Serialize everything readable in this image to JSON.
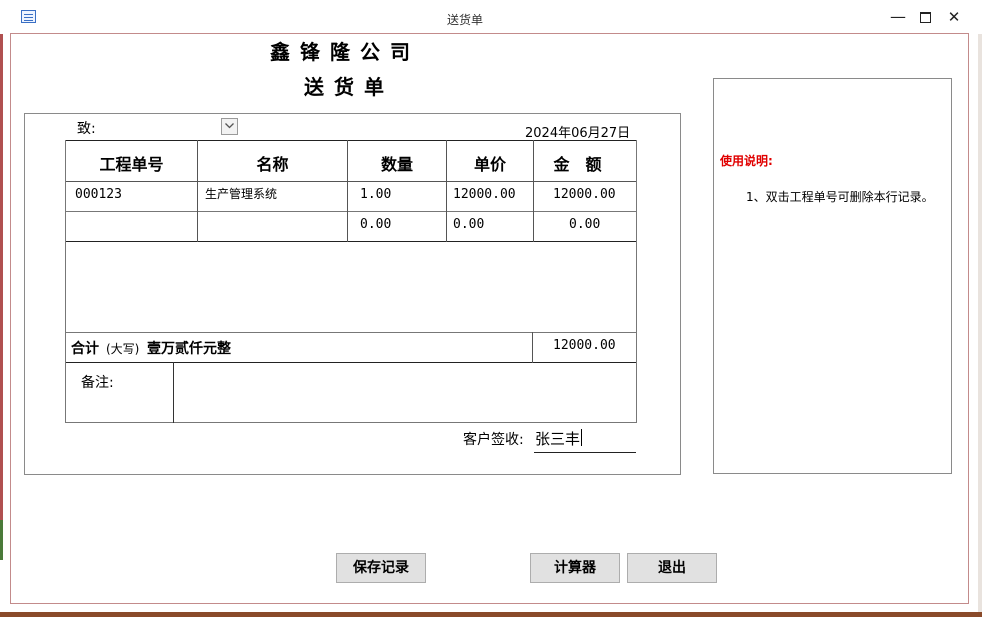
{
  "window": {
    "title": "送货单",
    "icon": "form-icon",
    "controls": {
      "minimize": "minimize-icon",
      "maximize": "maximize-icon",
      "close": "close-icon"
    }
  },
  "header": {
    "company": "鑫锋隆公司",
    "doc_title": "送货单"
  },
  "form": {
    "to_label": "致:",
    "to_value": "",
    "date": "2024年06月27日",
    "columns": [
      "工程单号",
      "名称",
      "数量",
      "单价",
      "金　额"
    ],
    "rows": [
      {
        "order_no": "000123",
        "name": "生产管理系统",
        "qty": "1.00",
        "price": "12000.00",
        "amount": "12000.00"
      },
      {
        "order_no": "",
        "name": "",
        "qty": "0.00",
        "price": "0.00",
        "amount": "0.00"
      }
    ],
    "total_label": "合计",
    "total_caps_label": "(大写)",
    "total_caps": "壹万贰仟元整",
    "total_amount": "12000.00",
    "remark_label": "备注:",
    "remark_value": "",
    "sign_label": "客户签收:",
    "sign_value": "张三丰"
  },
  "help": {
    "title": "使用说明:",
    "text": "1、双击工程单号可删除本行记录。",
    "title_color": "#e00000"
  },
  "buttons": {
    "save": "保存记录",
    "calculator": "计算器",
    "exit": "退出"
  }
}
